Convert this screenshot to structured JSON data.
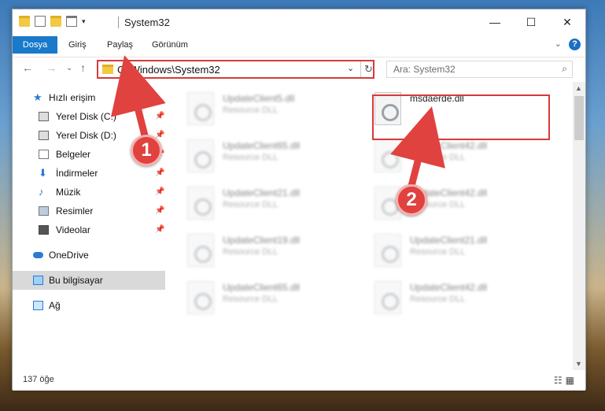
{
  "window": {
    "title": "System32",
    "minimize": "—",
    "maximize": "☐",
    "close": "✕"
  },
  "ribbon": {
    "tabs": [
      "Dosya",
      "Giriş",
      "Paylaş",
      "Görünüm"
    ],
    "help": "?"
  },
  "address": {
    "path": "C:\\Windows\\System32",
    "dropdown": "⌄",
    "refresh": "↻"
  },
  "search": {
    "placeholder": "Ara: System32",
    "icon": "⌕"
  },
  "nav": {
    "back": "←",
    "forward": "→",
    "recent": "⌄",
    "up": "↑"
  },
  "sidebar": {
    "items": [
      {
        "label": "Hızlı erişim",
        "icon": "star-icon",
        "pinned": false
      },
      {
        "label": "Yerel Disk (C:)",
        "icon": "drive-icon",
        "pinned": true
      },
      {
        "label": "Yerel Disk (D:)",
        "icon": "drive-icon",
        "pinned": true
      },
      {
        "label": "Belgeler",
        "icon": "documents-icon",
        "pinned": true
      },
      {
        "label": "İndirmeler",
        "icon": "download-icon",
        "pinned": true
      },
      {
        "label": "Müzik",
        "icon": "music-icon",
        "pinned": true
      },
      {
        "label": "Resimler",
        "icon": "pictures-icon",
        "pinned": true
      },
      {
        "label": "Videolar",
        "icon": "video-icon",
        "pinned": true
      },
      {
        "label": "OneDrive",
        "icon": "cloud-icon",
        "pinned": false
      },
      {
        "label": "Bu bilgisayar",
        "icon": "computer-icon",
        "pinned": false
      },
      {
        "label": "Ağ",
        "icon": "network-icon",
        "pinned": false
      }
    ]
  },
  "files": [
    {
      "name": "UpdateClient5.dll",
      "type": "Resource DLL"
    },
    {
      "name": "msdaerde.dll",
      "type": ""
    },
    {
      "name": "UpdateClient65.dll",
      "type": "Resource DLL"
    },
    {
      "name": "UpdateClient42.dll",
      "type": "Resource DLL"
    },
    {
      "name": "UpdateClient21.dll",
      "type": "Resource DLL"
    },
    {
      "name": "UpdateClient42.dll",
      "type": "Resource DLL"
    },
    {
      "name": "UpdateClient19.dll",
      "type": "Resource DLL"
    },
    {
      "name": "UpdateClient21.dll",
      "type": "Resource DLL"
    },
    {
      "name": "UpdateClient65.dll",
      "type": "Resource DLL"
    },
    {
      "name": "UpdateClient42.dll",
      "type": "Resource DLL"
    }
  ],
  "status": {
    "count": "137 öğe"
  },
  "annotations": {
    "badge1": "1",
    "badge2": "2",
    "color": "#e0423f"
  }
}
